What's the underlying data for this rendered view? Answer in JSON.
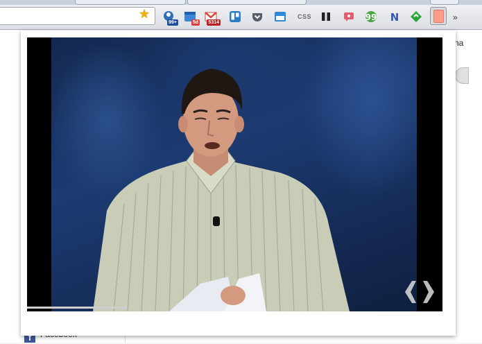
{
  "browser": {
    "bookmark_star": "star-icon",
    "extensions": [
      {
        "name": "extension-1",
        "badge": "99+",
        "color": "#2d6fb7",
        "badge_color": "#1b4e9c"
      },
      {
        "name": "extension-2",
        "badge": "5d",
        "color": "#3f86d6",
        "badge_color": "#d93b3b"
      },
      {
        "name": "gmail",
        "badge": "5314",
        "color": "#d9463b",
        "badge_color": "#b91f1f"
      },
      {
        "name": "trello",
        "badge": "",
        "color": "#2a7ec6"
      },
      {
        "name": "pocket",
        "badge": "",
        "color": "#555f6a"
      },
      {
        "name": "extension-6",
        "badge": "",
        "color": "#2c8ad8"
      },
      {
        "name": "css",
        "badge": "",
        "color": "#666"
      },
      {
        "name": "pause",
        "badge": "",
        "color": "#222"
      },
      {
        "name": "extension-9",
        "badge": "",
        "color": "#e25c6e"
      },
      {
        "name": "quote",
        "badge": "",
        "color": "#4aa441"
      },
      {
        "name": "n-logo",
        "badge": "",
        "color": "#3557b5"
      },
      {
        "name": "diamond",
        "badge": "",
        "color": "#2ea43c"
      },
      {
        "name": "extension-13",
        "badge": "",
        "color": "#ff9c88"
      }
    ],
    "overflow_label": "»"
  },
  "page": {
    "edge_text": "na",
    "facebook_label": "Facebook",
    "facebook_icon": "f"
  },
  "popup": {
    "video": {
      "watermark": "watermark-logo",
      "progress": 0.24
    }
  },
  "css_label": "CSS"
}
